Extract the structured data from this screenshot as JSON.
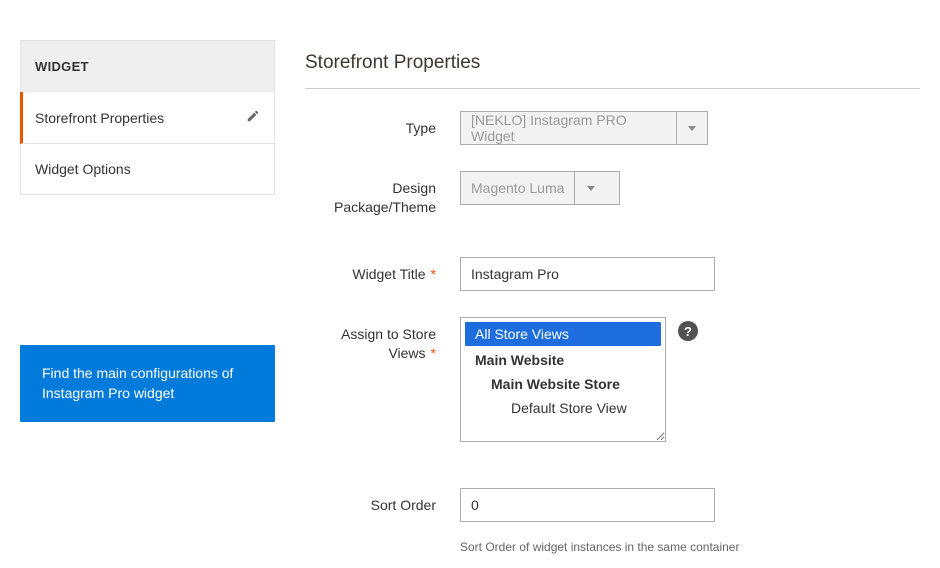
{
  "sidebar": {
    "header": "WIDGET",
    "items": [
      {
        "label": "Storefront Properties"
      },
      {
        "label": "Widget Options"
      }
    ]
  },
  "hint": {
    "text": "Find the main configurations of Instagram Pro widget"
  },
  "section": {
    "title": "Storefront Properties"
  },
  "form": {
    "type": {
      "label": "Type",
      "value": "[NEKLO] Instagram PRO Widget"
    },
    "theme": {
      "label": "Design Package/Theme",
      "value": "Magento Luma"
    },
    "title": {
      "label": "Widget Title",
      "value": "Instagram Pro"
    },
    "stores": {
      "label": "Assign to Store Views",
      "options": {
        "all": "All Store Views",
        "website": "Main Website",
        "store": "Main Website Store",
        "view": "Default Store View"
      }
    },
    "sort": {
      "label": "Sort Order",
      "value": "0",
      "help": "Sort Order of widget instances in the same container"
    }
  }
}
